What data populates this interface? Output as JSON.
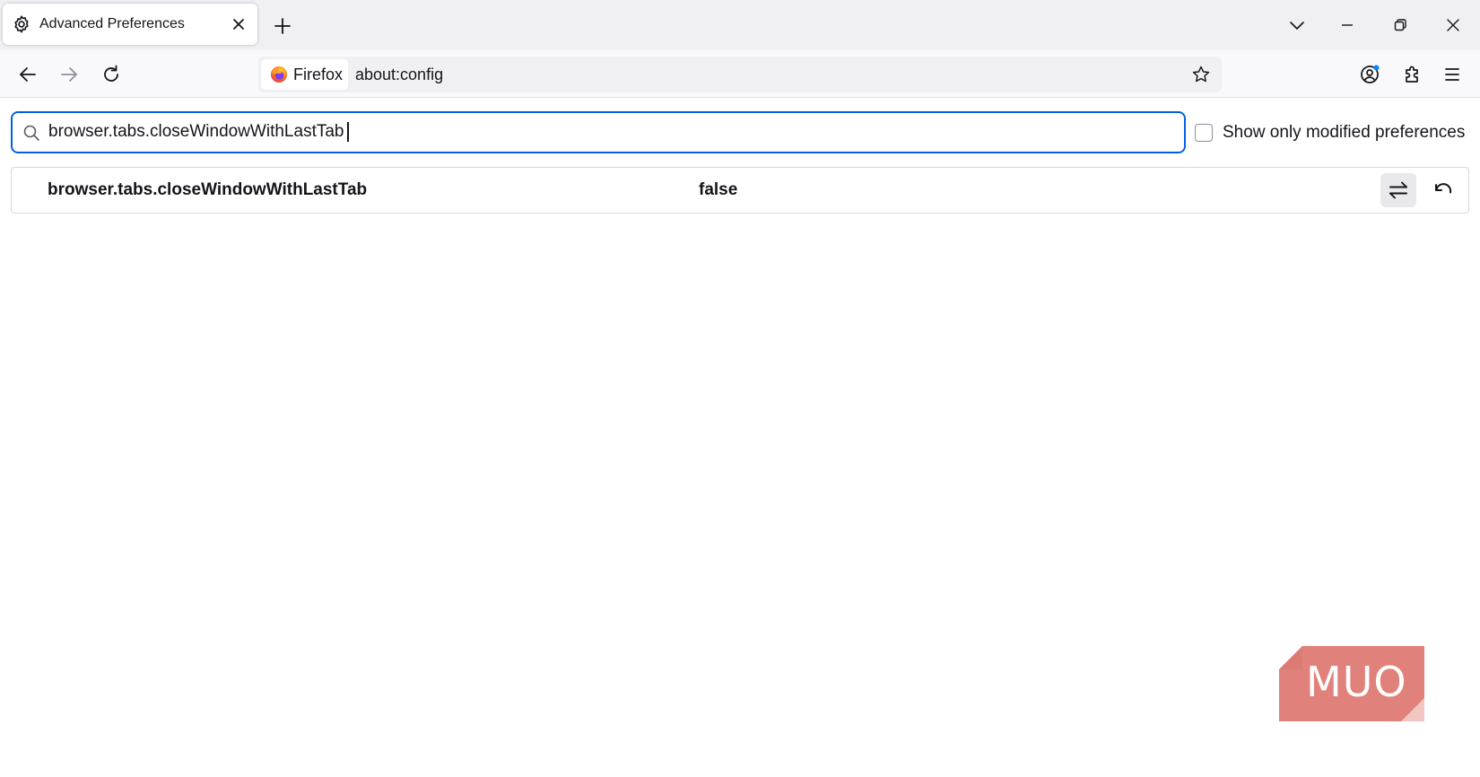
{
  "tab": {
    "title": "Advanced Preferences",
    "icon": "gear-icon"
  },
  "navbar": {
    "identity_label": "Firefox",
    "url": "about:config"
  },
  "search": {
    "value": "browser.tabs.closeWindowWithLastTab"
  },
  "filters": {
    "modified_only_label": "Show only modified preferences",
    "modified_only_checked": false
  },
  "preferences": [
    {
      "name": "browser.tabs.closeWindowWithLastTab",
      "value": "false"
    }
  ],
  "watermark": {
    "text": "MUO"
  },
  "colors": {
    "accent": "#0061e0",
    "tabstrip_bg": "#f0f0f4",
    "watermark": "#e0827b"
  }
}
